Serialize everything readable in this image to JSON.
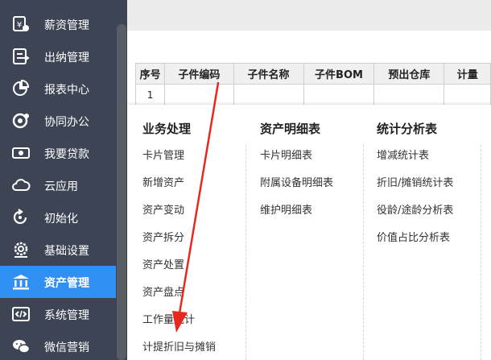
{
  "sidebar": {
    "items": [
      {
        "label": "薪资管理",
        "icon": "payroll-icon"
      },
      {
        "label": "出纳管理",
        "icon": "cashier-icon"
      },
      {
        "label": "报表中心",
        "icon": "pie-chart-icon"
      },
      {
        "label": "协同办公",
        "icon": "collaboration-icon"
      },
      {
        "label": "我要贷款",
        "icon": "money-icon"
      },
      {
        "label": "云应用",
        "icon": "cloud-icon"
      },
      {
        "label": "初始化",
        "icon": "refresh-icon"
      },
      {
        "label": "基础设置",
        "icon": "settings-icon"
      },
      {
        "label": "资产管理",
        "icon": "bank-icon",
        "active": true
      },
      {
        "label": "系统管理",
        "icon": "code-icon"
      },
      {
        "label": "微信营销",
        "icon": "wechat-icon"
      }
    ]
  },
  "table": {
    "headers": [
      "序号",
      "子件编码",
      "子件名称",
      "子件BOM",
      "预出仓库",
      "计量"
    ],
    "rows": [
      [
        "1",
        "",
        "",
        "",
        "",
        ""
      ]
    ]
  },
  "menu": {
    "columns": [
      {
        "title": "业务处理",
        "items": [
          "卡片管理",
          "新增资产",
          "资产变动",
          "资产拆分",
          "资产处置",
          "资产盘点",
          "工作量统计",
          "计提折旧与摊销"
        ]
      },
      {
        "title": "资产明细表",
        "items": [
          "卡片明细表",
          "附属设备明细表",
          "维护明细表"
        ]
      },
      {
        "title": "统计分析表",
        "items": [
          "增减统计表",
          "折旧/摊销统计表",
          "役龄/途龄分析表",
          "价值占比分析表"
        ]
      }
    ]
  },
  "colors": {
    "sidebar_bg": "#3d4554",
    "active_bg": "#2f8ff2",
    "arrow": "#e8281e"
  }
}
